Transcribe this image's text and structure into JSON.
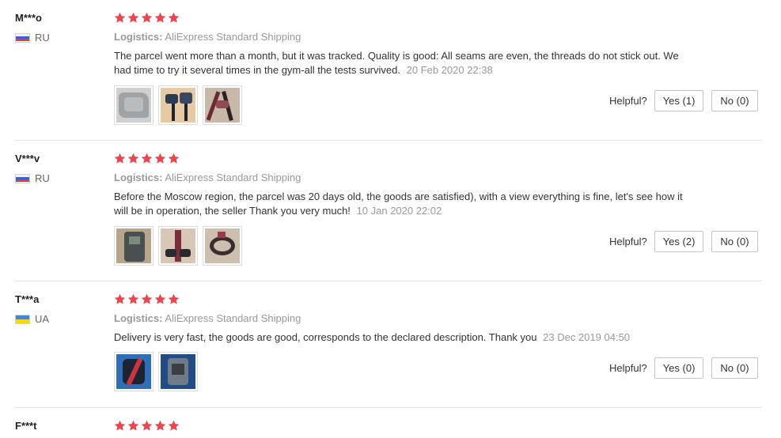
{
  "reviews": [
    {
      "user": "M***o",
      "country": "RU",
      "flag": "ru",
      "rating": 5,
      "logistics_label": "Logistics:",
      "logistics": "AliExpress Standard Shipping",
      "feedback": "The parcel went more than a month, but it was tracked. Quality is good: All seams are even, the threads do not stick out. We had time to try it several times in the gym-all the tests survived.",
      "time": "20 Feb 2020 22:38",
      "photos": [
        "grey-package-photo",
        "resistance-band-orange-photo",
        "resistance-band-dark-photo"
      ],
      "helpful_label": "Helpful?",
      "yes_label": "Yes (1)",
      "no_label": "No (0)"
    },
    {
      "user": "V***v",
      "country": "RU",
      "flag": "ru",
      "rating": 5,
      "logistics_label": "Logistics:",
      "logistics": "AliExpress Standard Shipping",
      "feedback": "Before the Moscow region, the parcel was 20 days old, the goods are satisfied), with a view everything is fine, let's see how it will be in operation, the seller Thank you very much!",
      "time": "10 Jan 2020 22:02",
      "photos": [
        "bands-package-photo",
        "band-handles-photo",
        "band-loop-photo"
      ],
      "helpful_label": "Helpful?",
      "yes_label": "Yes (2)",
      "no_label": "No (0)"
    },
    {
      "user": "T***a",
      "country": "UA",
      "flag": "ua",
      "rating": 5,
      "logistics_label": "Logistics:",
      "logistics": "AliExpress Standard Shipping",
      "feedback": "Delivery is very fast, the goods are good, corresponds to the declared description. Thank you",
      "time": "23 Dec 2019 04:50",
      "photos": [
        "band-blue-background-photo",
        "package-blue-background-photo"
      ],
      "helpful_label": "Helpful?",
      "yes_label": "Yes (0)",
      "no_label": "No (0)"
    },
    {
      "user": "F***t",
      "rating": 5
    }
  ],
  "colors": {
    "star": "#e5494f",
    "muted": "#999999",
    "border": "#c5c5c5"
  }
}
